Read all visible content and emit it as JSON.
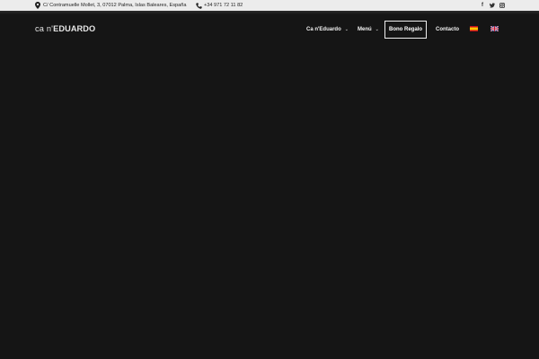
{
  "topbar": {
    "address_icon": "map-pin-icon",
    "address": "C/ Contramuelle Mollet, 3, 07012 Palma, Islas Baleares, España",
    "phone_icon": "phone-icon",
    "phone": "+34 971 72 11 82",
    "social": [
      {
        "name": "facebook-icon",
        "glyph": "f"
      },
      {
        "name": "twitter-icon",
        "glyph": "t"
      },
      {
        "name": "instagram-icon",
        "glyph": "◎"
      }
    ]
  },
  "brand": {
    "logo_part1": "ca n'",
    "logo_part2": "EDUARDO"
  },
  "nav": {
    "items": [
      {
        "label": "Ca n'Eduardo",
        "has_dropdown": true
      },
      {
        "label": "Menú",
        "has_dropdown": true
      },
      {
        "label": "Bono Regalo",
        "highlight": true
      },
      {
        "label": "Contacto"
      }
    ],
    "languages": [
      {
        "code": "es",
        "icon": "spain-flag-icon"
      },
      {
        "code": "en",
        "icon": "uk-flag-icon"
      }
    ],
    "chevron": "⌄"
  },
  "colors": {
    "background": "#151515",
    "topbar": "#ececec",
    "text_light": "#f2f2f2"
  }
}
